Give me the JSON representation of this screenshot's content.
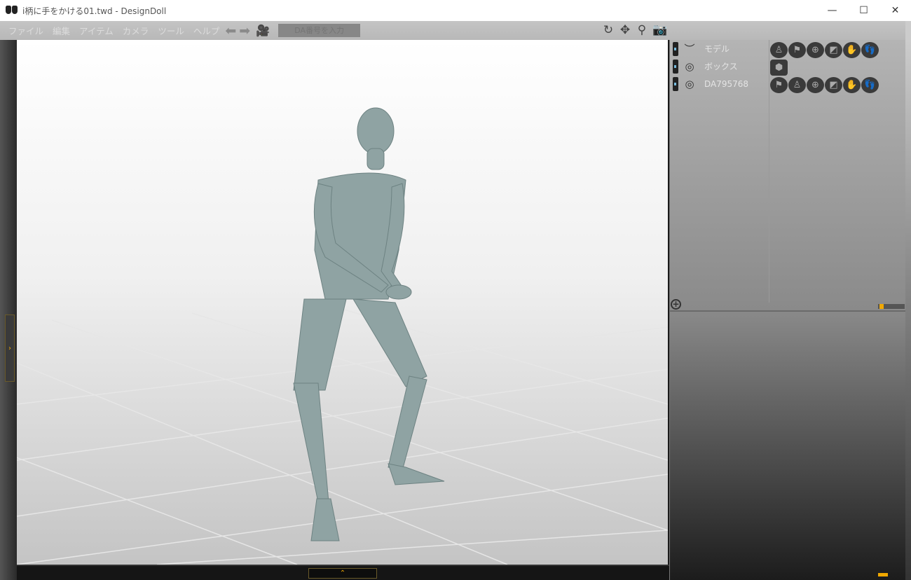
{
  "window": {
    "title": "i柄に手をかける01.twd - DesignDoll",
    "minimize": "—",
    "maximize": "☐",
    "close": "✕"
  },
  "menu": [
    "ファイル",
    "編集",
    "アイテム",
    "カメラ",
    "ツール",
    "ヘルプ"
  ],
  "toolbar": {
    "da_placeholder": "DA番号を入力"
  },
  "layers": [
    {
      "name": "モデル",
      "icon": "eye-closed-icon"
    },
    {
      "name": "ボックス",
      "icon": "eye-open-icon"
    },
    {
      "name": "DA795768",
      "icon": "eye-open-icon"
    }
  ],
  "colors": {
    "accent": "#f0a800",
    "figure": "#8fa3a3"
  },
  "slider": {
    "value": 0.05
  }
}
